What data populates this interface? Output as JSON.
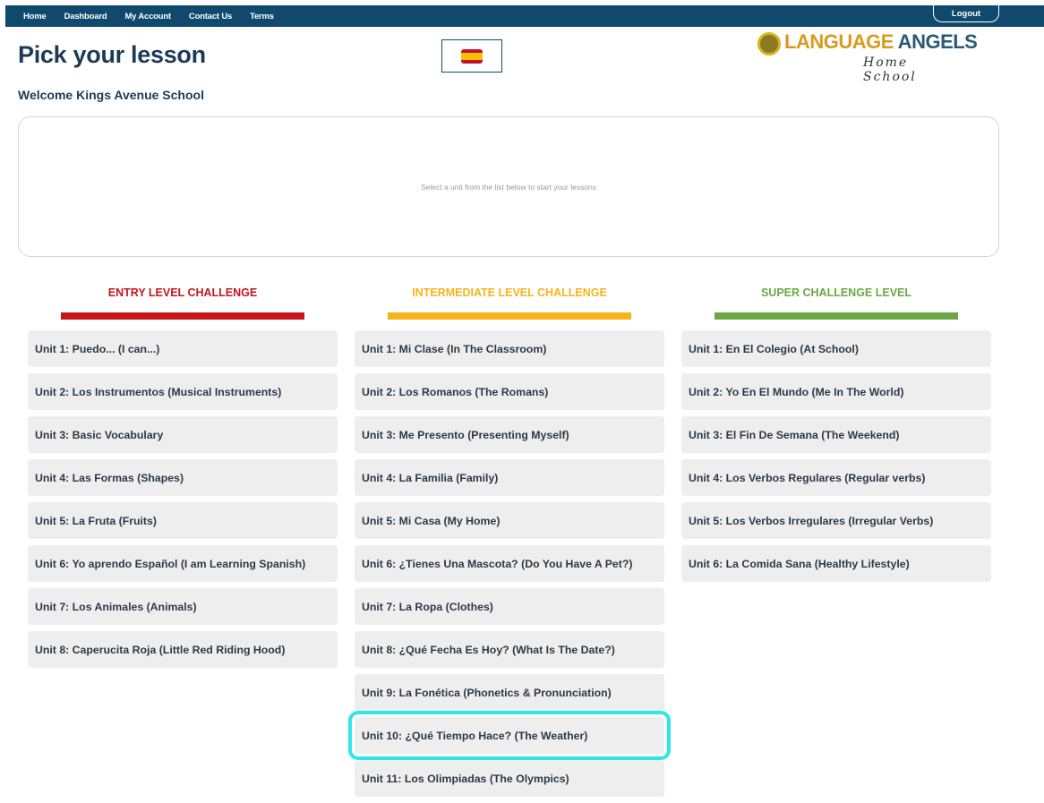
{
  "nav": {
    "items": [
      "Home",
      "Dashboard",
      "My Account",
      "Contact Us",
      "Terms"
    ],
    "logout": "Logout"
  },
  "header": {
    "title": "Pick your lesson",
    "welcome": "Welcome Kings Avenue School",
    "language_flag": "spain-flag-icon",
    "logo_brand_1": "LANGUAGE",
    "logo_brand_2": " ANGELS",
    "logo_sub": "Home School"
  },
  "info_box": {
    "message": "Select a unit from the list below to start your lessons"
  },
  "columns": {
    "entry": {
      "heading": "ENTRY LEVEL CHALLENGE",
      "color": "#c4161c",
      "units": [
        "Unit 1: Puedo... (I can...)",
        "Unit 2: Los Instrumentos (Musical Instruments)",
        "Unit 3: Basic Vocabulary",
        "Unit 4: Las Formas (Shapes)",
        "Unit 5: La Fruta (Fruits)",
        "Unit 6: Yo aprendo Español (I am Learning Spanish)",
        "Unit 7: Los Animales (Animals)",
        "Unit 8: Caperucita Roja (Little Red Riding Hood)"
      ]
    },
    "intermediate": {
      "heading": "INTERMEDIATE LEVEL CHALLENGE",
      "color": "#f7b319",
      "units": [
        "Unit 1: Mi Clase (In The Classroom)",
        "Unit 2: Los Romanos (The Romans)",
        "Unit 3: Me Presento (Presenting Myself)",
        "Unit 4: La Familia (Family)",
        "Unit 5: Mi Casa (My Home)",
        "Unit 6: ¿Tienes Una Mascota? (Do You Have A Pet?)",
        "Unit 7: La Ropa (Clothes)",
        "Unit 8: ¿Qué Fecha Es Hoy? (What Is The Date?)",
        "Unit 9: La Fonética (Phonetics & Pronunciation)",
        "Unit 10: ¿Qué Tiempo Hace? (The Weather)",
        "Unit 11: Los Olimpiadas (The Olympics)"
      ],
      "highlighted_index": 9
    },
    "super": {
      "heading": "SUPER CHALLENGE LEVEL",
      "color": "#6aa843",
      "units": [
        "Unit 1: En El Colegio (At School)",
        "Unit 2: Yo En El Mundo (Me In The World)",
        "Unit 3: El Fin De Semana (The Weekend)",
        "Unit 4: Los Verbos Regulares (Regular verbs)",
        "Unit 5: Los Verbos Irregulares (Irregular Verbs)",
        "Unit 6: La Comida Sana (Healthy Lifestyle)"
      ]
    }
  }
}
